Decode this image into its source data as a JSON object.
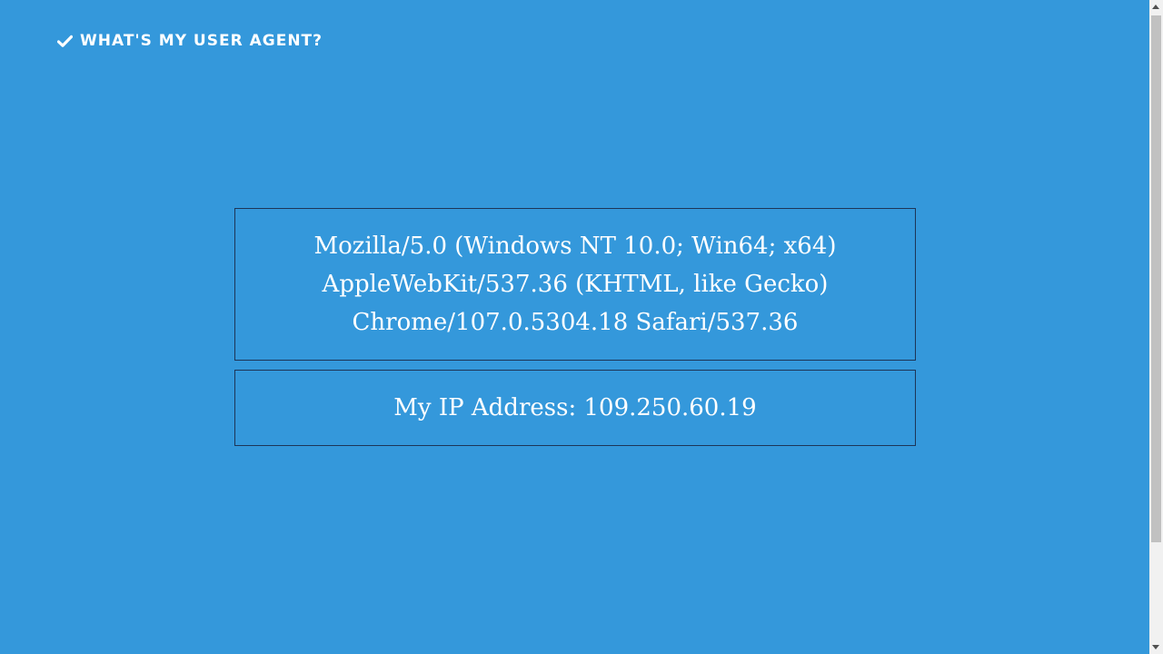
{
  "header": {
    "logo_icon": "check-icon",
    "title": "WHAT'S MY USER AGENT?"
  },
  "user_agent": {
    "line1": "Mozilla/5.0 (Windows NT 10.0; Win64; x64)",
    "line2": "AppleWebKit/537.36 (KHTML, like Gecko)",
    "line3": "Chrome/107.0.5304.18 Safari/537.36"
  },
  "ip": {
    "label": "My IP Address:",
    "value": "109.250.60.19"
  },
  "colors": {
    "background": "#3498db",
    "text": "#ffffff",
    "border": "#1d3557"
  }
}
